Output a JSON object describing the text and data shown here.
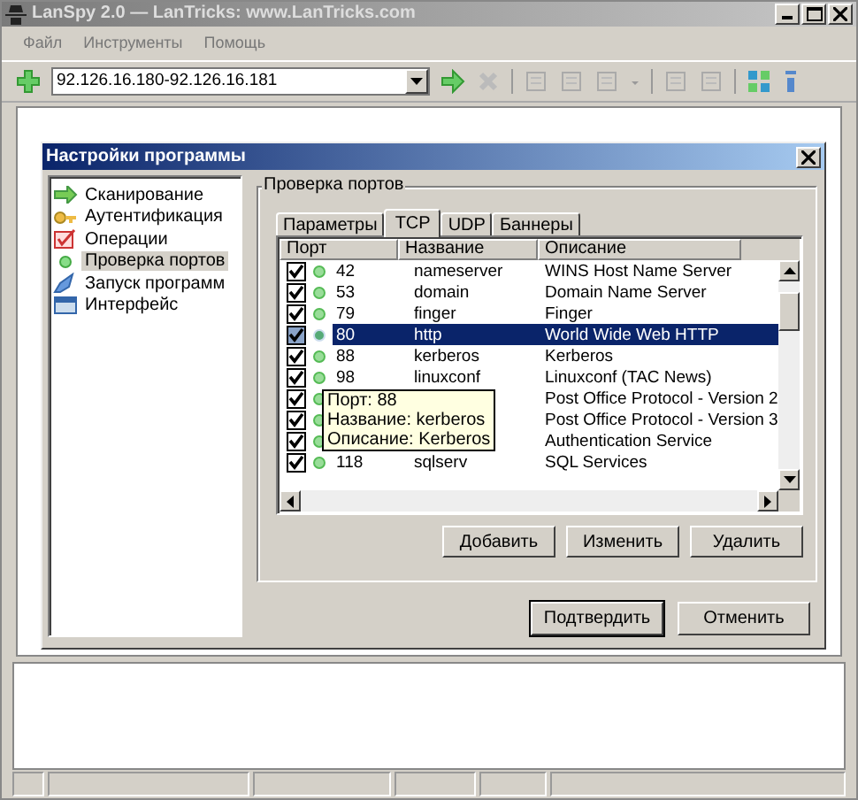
{
  "window": {
    "title": "LanSpy 2.0 — LanTricks: www.LanTricks.com"
  },
  "menu": [
    "Файл",
    "Инструменты",
    "Помощь"
  ],
  "address": {
    "value": "92.126.16.180-92.126.16.181"
  },
  "dialog": {
    "title": "Настройки программы",
    "tree": [
      {
        "label": "Сканирование",
        "kind": "scan",
        "selected": false
      },
      {
        "label": "Аутентификация",
        "kind": "key",
        "selected": false
      },
      {
        "label": "Операции",
        "kind": "ops",
        "selected": false
      },
      {
        "label": "Проверка портов",
        "kind": "dot",
        "selected": true
      },
      {
        "label": "Запуск программ",
        "kind": "run",
        "selected": false
      },
      {
        "label": "Интерфейс",
        "kind": "ui",
        "selected": false
      }
    ],
    "group_title": "Проверка портов",
    "tabs": [
      {
        "label": "Параметры",
        "selected": false
      },
      {
        "label": "TCP",
        "selected": true
      },
      {
        "label": "UDP",
        "selected": false
      },
      {
        "label": "Баннеры",
        "selected": false
      }
    ],
    "columns": [
      "Порт",
      "Название",
      "Описание"
    ],
    "rows": [
      {
        "checked": true,
        "selected": false,
        "port": "42",
        "name": "nameserver",
        "description": "WINS Host Name Server"
      },
      {
        "checked": true,
        "selected": false,
        "port": "53",
        "name": "domain",
        "description": "Domain Name Server"
      },
      {
        "checked": true,
        "selected": false,
        "port": "79",
        "name": "finger",
        "description": "Finger"
      },
      {
        "checked": true,
        "selected": true,
        "port": "80",
        "name": "http",
        "description": "World Wide Web HTTP"
      },
      {
        "checked": true,
        "selected": false,
        "port": "88",
        "name": "kerberos",
        "description": "Kerberos"
      },
      {
        "checked": true,
        "selected": false,
        "port": "98",
        "name": "linuxconf",
        "description": "Linuxconf (TAC News)"
      },
      {
        "checked": true,
        "selected": false,
        "description": "Post Office Protocol - Version 2"
      },
      {
        "checked": true,
        "selected": false,
        "description": "Post Office Protocol - Version 3"
      },
      {
        "checked": true,
        "selected": false,
        "description": "Authentication Service"
      },
      {
        "checked": true,
        "selected": false,
        "port": "118",
        "name": "sqlserv",
        "description": "SQL Services"
      }
    ],
    "tooltip": [
      "Порт: 88",
      "Название: kerberos",
      "Описание: Kerberos"
    ],
    "list_buttons": [
      "Добавить",
      "Изменить",
      "Удалить"
    ],
    "buttons": [
      "Подтвердить",
      "Отменить"
    ]
  }
}
